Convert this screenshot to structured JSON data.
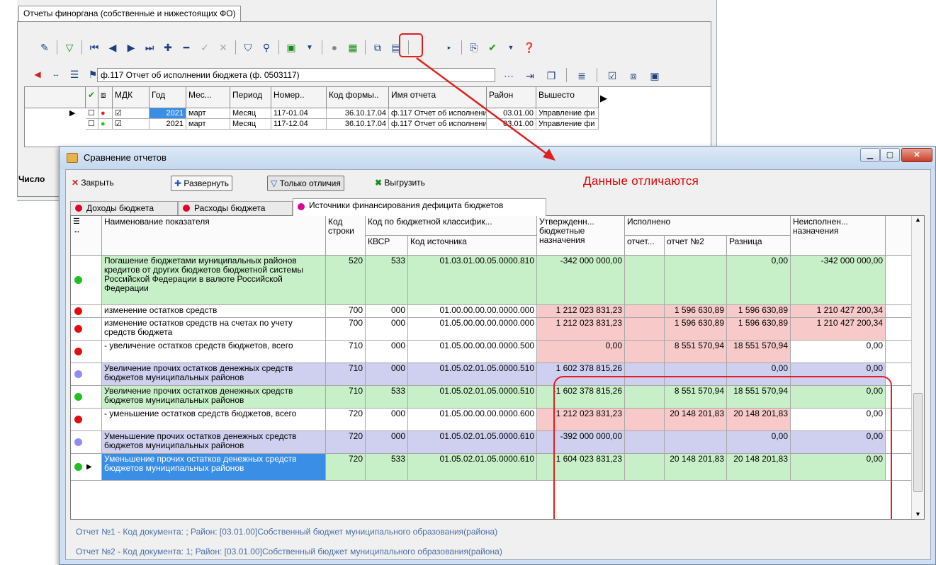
{
  "background": {
    "tab_title": "Отчеты финоргана (собственные и нижестоящих ФО)",
    "report_selector": "ф.117 Отчет об исполнении бюджета (ф. 0503117)",
    "grid_headers": [
      "МДК",
      "Год",
      "Мес...",
      "Период",
      "Номер..",
      "Код формы..",
      "Имя отчета",
      "Район",
      "Вышесто"
    ],
    "grid_rows": [
      {
        "year": "2021",
        "month": "март",
        "period": "Месяц",
        "number": "117-01.04",
        "form_code": "36.10.17.04",
        "name": "ф.117 Отчет об исполнении",
        "district": "03.01.00",
        "upper": "Управление фи",
        "dot_color": "#e02020"
      },
      {
        "year": "2021",
        "month": "март",
        "period": "Месяц",
        "number": "117-12.04",
        "form_code": "36.10.17.04",
        "name": "ф.117 Отчет об исполнении",
        "district": "03.01.00",
        "upper": "Управление фи",
        "dot_color": "#20c020"
      }
    ],
    "status_label": "Число"
  },
  "dialog": {
    "title": "Сравнение отчетов",
    "toolbar": {
      "close": "Закрыть",
      "expand": "Развернуть",
      "only_diff": "Только отличия",
      "export": "Выгрузить"
    },
    "diff_message": "Данные отличаются",
    "tabs": [
      {
        "label": "Доходы бюджета",
        "dot": "#e0002a"
      },
      {
        "label": "Расходы бюджета",
        "dot": "#e0002a"
      },
      {
        "label": "Источники финансирования дефицита бюджетов",
        "dot": "#e0009a"
      }
    ],
    "headers": {
      "name": "Наименование показателя",
      "line_code": "Код строки",
      "budget_class": "Код по бюджетной классифик...",
      "kvsr": "КВСР",
      "source_code": "Код источника",
      "approved": "Утвержденн... бюджетные назначения",
      "executed": "Исполнено",
      "report1": "отчет...",
      "report2": "отчет №2",
      "difference": "Разница",
      "unexecuted": "Неисполнен... назначения"
    },
    "rows": [
      {
        "name": "Погашение бюджетами муниципальных районов кредитов от других бюджетов бюджетной системы Российской Федерации в валюте Российской Федерации",
        "line": "520",
        "kvsr": "533",
        "source": "01.03.01.00.05.0000.810",
        "approved": "-342 000 000,00",
        "rep1": "",
        "rep2": "",
        "diff": "0,00",
        "unexec": "-342 000 000,00",
        "status": "green"
      },
      {
        "name": "изменение остатков средств",
        "line": "700",
        "kvsr": "000",
        "source": "01.00.00.00.00.0000.000",
        "approved": "1 212 023 831,23",
        "rep1": "",
        "rep2": "1 596 630,89",
        "diff": "1 596 630,89",
        "unexec": "1 210 427 200,34",
        "status": "red"
      },
      {
        "name": "изменение остатков средств на счетах по учету средств бюджета",
        "line": "700",
        "kvsr": "000",
        "source": "01.05.00.00.00.0000.000",
        "approved": "1 212 023 831,23",
        "rep1": "",
        "rep2": "1 596 630,89",
        "diff": "1 596 630,89",
        "unexec": "1 210 427 200,34",
        "status": "red"
      },
      {
        "name": " - увеличение остатков средств бюджетов, всего",
        "line": "710",
        "kvsr": "000",
        "source": "01.05.00.00.00.0000.500",
        "approved": "0,00",
        "rep1": "",
        "rep2": "8 551 570,94",
        "diff": "18 551 570,94",
        "unexec": "0,00",
        "status": "red"
      },
      {
        "name": "Увеличение прочих остатков денежных средств бюджетов муниципальных районов",
        "line": "710",
        "kvsr": "000",
        "source": "01.05.02.01.05.0000.510",
        "approved": "1 602 378 815,26",
        "rep1": "",
        "rep2": "",
        "diff": "0,00",
        "unexec": "0,00",
        "status": "blue"
      },
      {
        "name": "Увеличение прочих остатков денежных средств бюджетов муниципальных районов",
        "line": "710",
        "kvsr": "533",
        "source": "01.05.02.01.05.0000.510",
        "approved": "-1 602 378 815,26",
        "rep1": "",
        "rep2": "8 551 570,94",
        "diff": "18 551 570,94",
        "unexec": "0,00",
        "status": "green"
      },
      {
        "name": " - уменьшение остатков средств бюджетов, всего",
        "line": "720",
        "kvsr": "000",
        "source": "01.05.00.00.00.0000.600",
        "approved": "1 212 023 831,23",
        "rep1": "",
        "rep2": "20 148 201,83",
        "diff": "20 148 201,83",
        "unexec": "0,00",
        "status": "red"
      },
      {
        "name": "Уменьшение прочих остатков денежных средств бюджетов муниципальных районов",
        "line": "720",
        "kvsr": "000",
        "source": "01.05.02.01.05.0000.610",
        "approved": "-392 000 000,00",
        "rep1": "",
        "rep2": "",
        "diff": "0,00",
        "unexec": "0,00",
        "status": "blue"
      },
      {
        "name": "Уменьшение прочих остатков денежных средств бюджетов муниципальных районов",
        "line": "720",
        "kvsr": "533",
        "source": "01.05.02.01.05.0000.610",
        "approved": "1 604 023 831,23",
        "rep1": "",
        "rep2": "20 148 201,83",
        "diff": "20 148 201,83",
        "unexec": "0,00",
        "status": "green"
      }
    ],
    "footer": {
      "report1": "Отчет №1  - Код документа: ; Район: [03.01.00]Собственный бюджет муниципального образования(района)",
      "report2": "Отчет №2  - Код документа: 1; Район: [03.01.00]Собственный бюджет муниципального образования(района)"
    }
  },
  "colors": {
    "green_row": "#c8f0c8",
    "red_row": "#f7c9c9",
    "blue_row": "#cfcfef",
    "selected_row": "#3a8ee6",
    "status_red": "#e01010",
    "status_green": "#20c020",
    "status_blue": "#8e8ef0",
    "highlight": "#e02020"
  }
}
